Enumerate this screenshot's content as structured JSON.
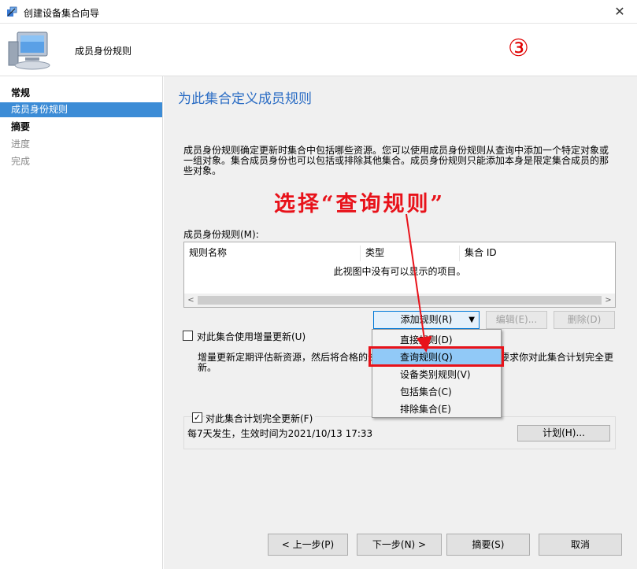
{
  "window": {
    "title": "创建设备集合向导",
    "close_glyph": "✕"
  },
  "header": {
    "step_title": "成员身份规则",
    "step_number": "③"
  },
  "sidebar": {
    "items": [
      {
        "label": "常规",
        "state": "done"
      },
      {
        "label": "成员身份规则",
        "state": "active"
      },
      {
        "label": "摘要",
        "state": "bold"
      },
      {
        "label": "进度",
        "state": "pending"
      },
      {
        "label": "完成",
        "state": "pending"
      }
    ]
  },
  "main": {
    "heading": "为此集合定义成员规则",
    "description": "成员身份规则确定更新时集合中包括哪些资源。您可以使用成员身份规则从查询中添加一个特定对象或一组对象。集合成员身份也可以包括或排除其他集合。成员身份规则只能添加本身是限定集合成员的那些对象。",
    "annotation": "选择“查询规则”",
    "rules_label": "成员身份规则(M):",
    "columns": [
      "规则名称",
      "类型",
      "集合 ID"
    ],
    "empty_text": "此视图中没有可以显示的项目。",
    "add_rule_button": "添加规则(R)",
    "edit_button": "编辑(E)...",
    "delete_button": "删除(D)",
    "incremental_checkbox": {
      "label": "对此集合使用增量更新(U)",
      "checked": false
    },
    "incremental_desc": "增量更新定期评估新资源，然后将合格的资源添加到此集合。增量更新不要求你对此集合计划完全更新。",
    "full_update_checkbox": {
      "label": "对此集合计划完全更新(F)",
      "checked": true
    },
    "schedule_text": "每7天发生，生效时间为2021/10/13 17:33",
    "schedule_button": "计划(H)..."
  },
  "dropdown": {
    "items": [
      {
        "label": "直接规则(D)"
      },
      {
        "label": "查询规则(Q)",
        "highlighted": true
      },
      {
        "label": "设备类别规则(V)"
      },
      {
        "label": "包括集合(C)"
      },
      {
        "label": "排除集合(E)"
      }
    ]
  },
  "footer": {
    "prev": "< 上一步(P)",
    "next": "下一步(N) >",
    "summary": "摘要(S)",
    "cancel": "取消"
  },
  "colors": {
    "accent": "#3c8cd6",
    "heading": "#2a6cc4",
    "annotation": "#e8121a",
    "menu_highlight": "#91c9f7"
  },
  "icons": [
    "wizard-icon",
    "computer-icon",
    "close-icon",
    "dropdown-arrow-icon",
    "scroll-left-icon",
    "scroll-right-icon",
    "check-icon",
    "annotation-arrow"
  ]
}
